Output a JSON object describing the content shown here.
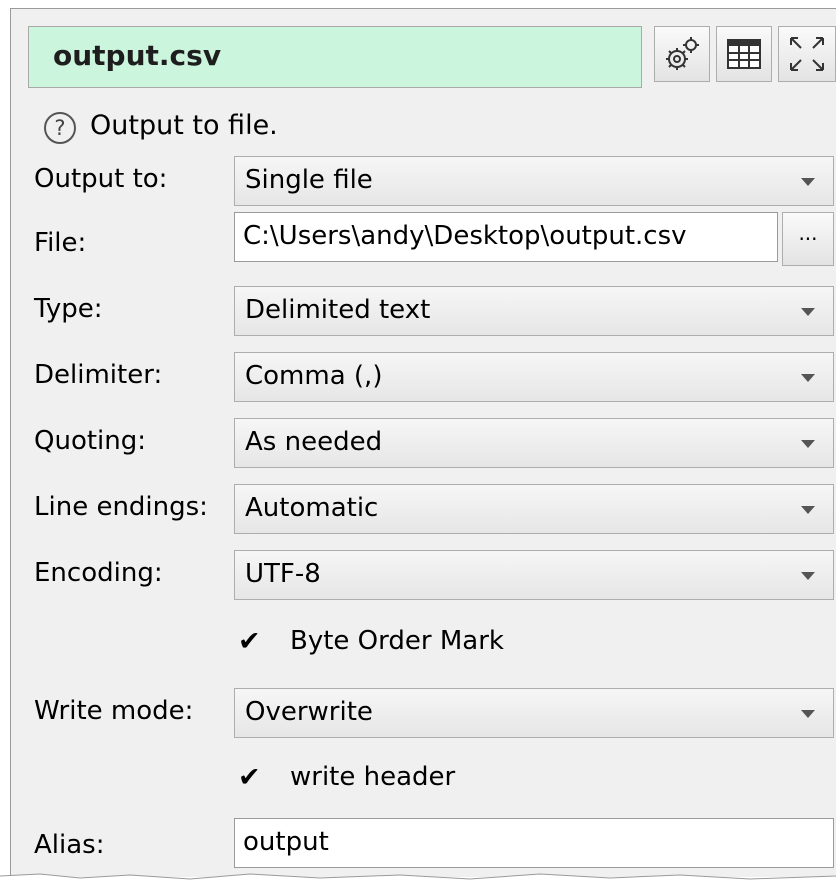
{
  "header": {
    "title": "output.csv"
  },
  "toolbar": {
    "icons": [
      "settings-gears-icon",
      "table-view-icon",
      "expand-icon"
    ]
  },
  "help": {
    "icon": "?",
    "text": "Output to file."
  },
  "fields": {
    "output_to": {
      "label": "Output to:",
      "value": "Single file"
    },
    "file": {
      "label": "File:",
      "value": "C:\\Users\\andy\\Desktop\\output.csv",
      "browse": "..."
    },
    "type": {
      "label": "Type:",
      "value": "Delimited text"
    },
    "delimiter": {
      "label": "Delimiter:",
      "value": "Comma (,)"
    },
    "quoting": {
      "label": "Quoting:",
      "value": "As needed"
    },
    "line_endings": {
      "label": "Line endings:",
      "value": "Automatic"
    },
    "encoding": {
      "label": "Encoding:",
      "value": "UTF-8"
    },
    "bom": {
      "checkmark": "✔",
      "label": "Byte Order Mark",
      "checked": true
    },
    "write_mode": {
      "label": "Write mode:",
      "value": "Overwrite"
    },
    "write_header": {
      "checkmark": "✔",
      "label": "write header",
      "checked": true
    },
    "alias": {
      "label": "Alias:",
      "value": "output"
    }
  },
  "colors": {
    "title_background": "#ccf5dd",
    "panel_background": "#f0f0f0"
  }
}
